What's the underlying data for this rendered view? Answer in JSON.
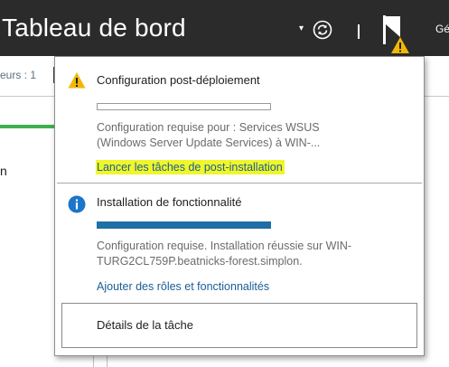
{
  "header": {
    "title": "Tableau de bord",
    "dropdown_glyph": "▾",
    "refresh_icon": "refresh-icon",
    "flag_icon": "notifications-flag-icon",
    "manage_label": "Gé"
  },
  "background": {
    "roles_label": "eurs : 1",
    "cutoff_text": "n",
    "accent_green": "#3fb04f"
  },
  "notifications": [
    {
      "icon": "warning-icon",
      "title": "Configuration post-déploiement",
      "progress": 0,
      "description": [
        "Configuration requise pour : Services WSUS",
        "(Windows Server Update Services) à WIN-..."
      ],
      "link": "Lancer les tâches de post-installation",
      "link_highlighted": true
    },
    {
      "icon": "info-icon",
      "title": "Installation de fonctionnalité",
      "progress": 1,
      "description": [
        "Configuration requise. Installation réussie sur WIN-",
        "TURG2CL759P.beatnicks-forest.simplon."
      ],
      "link": "Ajouter des rôles et fonctionnalités",
      "link_highlighted": false
    }
  ],
  "task_details_label": "Détails de la tâche",
  "colors": {
    "titlebar": "#2b2b2b",
    "link": "#1a5d96",
    "progress_fill": "#1e6fa6",
    "highlight": "#f0f62a",
    "warning": "#f2b705",
    "info": "#1b75c9"
  }
}
